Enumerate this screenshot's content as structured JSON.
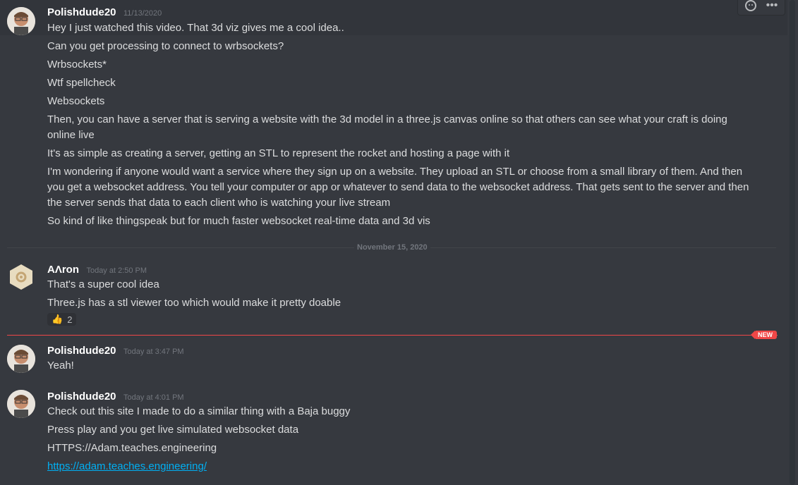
{
  "messages": [
    {
      "username": "Polishdude20",
      "timestamp": "11/13/2020",
      "lines": [
        "Hey I just watched this video. That 3d viz gives me a cool idea..",
        "Can you get processing to connect to wrbsockets?",
        "Wrbsockets*",
        "Wtf spellcheck",
        "Websockets",
        "Then, you can have a server that is serving a website with the 3d model in a three.js canvas online so that others can see what your craft is doing online live",
        "It's as simple as creating a server, getting an STL to represent the rocket and hosting a page with it",
        "I'm wondering if anyone would want a service where they sign up on a website. They upload an STL or choose from a small library of them. And then you get a websocket address. You tell your computer or app or whatever to send data to the websocket address. That gets sent to the server and then the server sends that data to each client who is watching your live stream",
        "So kind of like thingspeak but for much faster websocket real-time data and 3d vis"
      ]
    },
    {
      "username": "AΛron",
      "timestamp": "Today at 2:50 PM",
      "lines": [
        "That's a super cool idea",
        "Three.js has a stl viewer too which would make it pretty doable"
      ],
      "reaction": {
        "emoji": "👍",
        "count": "2"
      }
    },
    {
      "username": "Polishdude20",
      "timestamp": "Today at 3:47 PM",
      "lines": [
        "Yeah!"
      ]
    },
    {
      "username": "Polishdude20",
      "timestamp": "Today at 4:01 PM",
      "lines": [
        "Check out this site I made to do a similar thing with a Baja buggy",
        "Press play and you get live simulated websocket data",
        "HTTPS://Adam.teaches.engineering",
        "https://adam.teaches.engineering/"
      ]
    }
  ],
  "date_divider": "November 15, 2020",
  "new_badge": "NEW",
  "toolbar": {
    "icons": [
      "add-reaction-icon",
      "more-icon"
    ],
    "more_label": "•••"
  },
  "colors": {
    "background": "#36393f",
    "link": "#00b0f4",
    "new": "#f04747"
  }
}
